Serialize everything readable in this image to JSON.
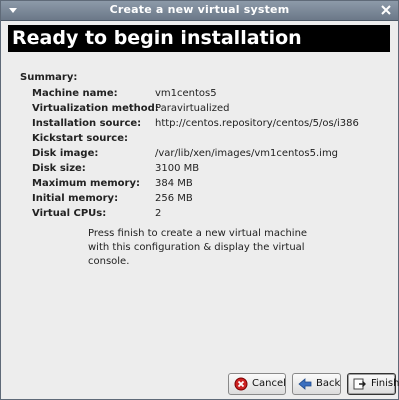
{
  "window": {
    "title": "Create a new virtual system"
  },
  "banner": {
    "title": "Ready to begin installation"
  },
  "summary": {
    "label": "Summary:",
    "rows": [
      {
        "key": "Machine name:",
        "value": "vm1centos5"
      },
      {
        "key": "Virtualization method:",
        "value": "Paravirtualized"
      },
      {
        "key": "Installation source:",
        "value": "http://centos.repository/centos/5/os/i386"
      },
      {
        "key": "Kickstart source:",
        "value": ""
      },
      {
        "key": "Disk image:",
        "value": "/var/lib/xen/images/vm1centos5.img"
      },
      {
        "key": "Disk size:",
        "value": "3100 MB"
      },
      {
        "key": "Maximum memory:",
        "value": "384 MB"
      },
      {
        "key": "Initial memory:",
        "value": "256 MB"
      },
      {
        "key": "Virtual CPUs:",
        "value": "2"
      }
    ]
  },
  "note": "Press finish to create a new virtual machine with this configuration & display the virtual console.",
  "buttons": {
    "cancel": "Cancel",
    "back": "Back",
    "finish": "Finish"
  },
  "icons": {
    "window_menu": "window-menu-icon",
    "close": "close-icon",
    "cancel": "cancel-icon",
    "back": "back-arrow-icon",
    "finish": "finish-icon"
  },
  "colors": {
    "titlebar": "#7b8898",
    "banner_bg": "#000000",
    "banner_text": "#ffffff",
    "cancel_icon": "#cc0000",
    "back_arrow": "#3a6fbf"
  }
}
